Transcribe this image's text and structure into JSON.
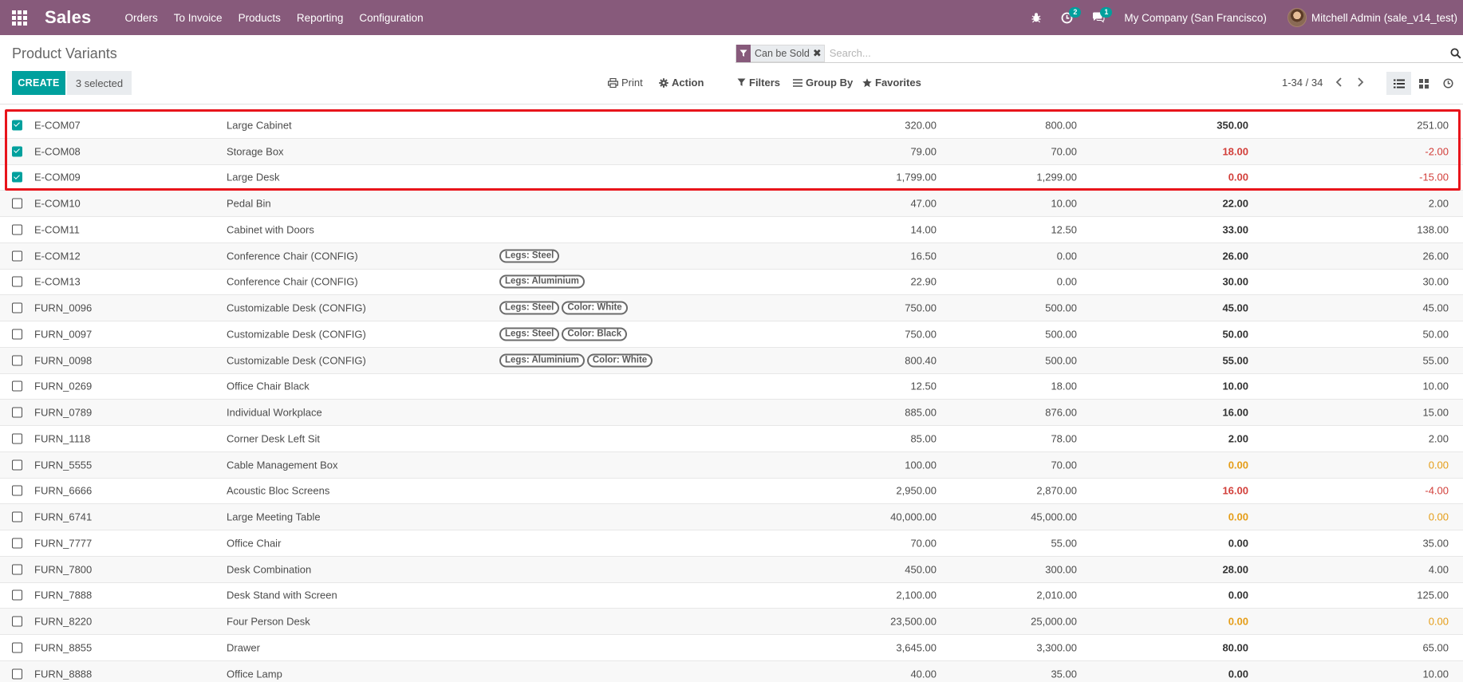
{
  "navbar": {
    "app_name": "Sales",
    "menu": [
      "Orders",
      "To Invoice",
      "Products",
      "Reporting",
      "Configuration"
    ],
    "activity_count": "2",
    "messages_count": "1",
    "company": "My Company (San Francisco)",
    "user": "Mitchell Admin (sale_v14_test)",
    "bg_color": "#875a7b"
  },
  "control_panel": {
    "title": "Product Variants",
    "create_label": "CREATE",
    "selected_label": "3 selected",
    "print_label": "Print",
    "action_label": "Action",
    "filters_label": "Filters",
    "group_by_label": "Group By",
    "favorites_label": "Favorites",
    "pager": "1-34 / 34",
    "facet_label": "Can be Sold",
    "facet_remove": "✖",
    "search_placeholder": "Search..."
  },
  "rows": [
    {
      "checked": true,
      "ref": "E-COM07",
      "name": "Large Cabinet",
      "attrs": [],
      "price": "320.00",
      "cost": "800.00",
      "onhand": "350.00",
      "onhand_color": "",
      "forecast": "251.00",
      "forecast_color": ""
    },
    {
      "checked": true,
      "ref": "E-COM08",
      "name": "Storage Box",
      "attrs": [],
      "price": "79.00",
      "cost": "70.00",
      "onhand": "18.00",
      "onhand_color": "red",
      "forecast": "-2.00",
      "forecast_color": "red"
    },
    {
      "checked": true,
      "ref": "E-COM09",
      "name": "Large Desk",
      "attrs": [],
      "price": "1,799.00",
      "cost": "1,299.00",
      "onhand": "0.00",
      "onhand_color": "red",
      "forecast": "-15.00",
      "forecast_color": "red"
    },
    {
      "checked": false,
      "ref": "E-COM10",
      "name": "Pedal Bin",
      "attrs": [],
      "price": "47.00",
      "cost": "10.00",
      "onhand": "22.00",
      "onhand_color": "",
      "forecast": "2.00",
      "forecast_color": ""
    },
    {
      "checked": false,
      "ref": "E-COM11",
      "name": "Cabinet with Doors",
      "attrs": [],
      "price": "14.00",
      "cost": "12.50",
      "onhand": "33.00",
      "onhand_color": "",
      "forecast": "138.00",
      "forecast_color": ""
    },
    {
      "checked": false,
      "ref": "E-COM12",
      "name": "Conference Chair (CONFIG)",
      "attrs": [
        "Legs: Steel"
      ],
      "price": "16.50",
      "cost": "0.00",
      "onhand": "26.00",
      "onhand_color": "",
      "forecast": "26.00",
      "forecast_color": ""
    },
    {
      "checked": false,
      "ref": "E-COM13",
      "name": "Conference Chair (CONFIG)",
      "attrs": [
        "Legs: Aluminium"
      ],
      "price": "22.90",
      "cost": "0.00",
      "onhand": "30.00",
      "onhand_color": "",
      "forecast": "30.00",
      "forecast_color": ""
    },
    {
      "checked": false,
      "ref": "FURN_0096",
      "name": "Customizable Desk (CONFIG)",
      "attrs": [
        "Legs: Steel",
        "Color: White"
      ],
      "price": "750.00",
      "cost": "500.00",
      "onhand": "45.00",
      "onhand_color": "",
      "forecast": "45.00",
      "forecast_color": ""
    },
    {
      "checked": false,
      "ref": "FURN_0097",
      "name": "Customizable Desk (CONFIG)",
      "attrs": [
        "Legs: Steel",
        "Color: Black"
      ],
      "price": "750.00",
      "cost": "500.00",
      "onhand": "50.00",
      "onhand_color": "",
      "forecast": "50.00",
      "forecast_color": ""
    },
    {
      "checked": false,
      "ref": "FURN_0098",
      "name": "Customizable Desk (CONFIG)",
      "attrs": [
        "Legs: Aluminium",
        "Color: White"
      ],
      "price": "800.40",
      "cost": "500.00",
      "onhand": "55.00",
      "onhand_color": "",
      "forecast": "55.00",
      "forecast_color": ""
    },
    {
      "checked": false,
      "ref": "FURN_0269",
      "name": "Office Chair Black",
      "attrs": [],
      "price": "12.50",
      "cost": "18.00",
      "onhand": "10.00",
      "onhand_color": "",
      "forecast": "10.00",
      "forecast_color": ""
    },
    {
      "checked": false,
      "ref": "FURN_0789",
      "name": "Individual Workplace",
      "attrs": [],
      "price": "885.00",
      "cost": "876.00",
      "onhand": "16.00",
      "onhand_color": "",
      "forecast": "15.00",
      "forecast_color": ""
    },
    {
      "checked": false,
      "ref": "FURN_1118",
      "name": "Corner Desk Left Sit",
      "attrs": [],
      "price": "85.00",
      "cost": "78.00",
      "onhand": "2.00",
      "onhand_color": "",
      "forecast": "2.00",
      "forecast_color": ""
    },
    {
      "checked": false,
      "ref": "FURN_5555",
      "name": "Cable Management Box",
      "attrs": [],
      "price": "100.00",
      "cost": "70.00",
      "onhand": "0.00",
      "onhand_color": "orange",
      "forecast": "0.00",
      "forecast_color": "orange"
    },
    {
      "checked": false,
      "ref": "FURN_6666",
      "name": "Acoustic Bloc Screens",
      "attrs": [],
      "price": "2,950.00",
      "cost": "2,870.00",
      "onhand": "16.00",
      "onhand_color": "red",
      "forecast": "-4.00",
      "forecast_color": "red"
    },
    {
      "checked": false,
      "ref": "FURN_6741",
      "name": "Large Meeting Table",
      "attrs": [],
      "price": "40,000.00",
      "cost": "45,000.00",
      "onhand": "0.00",
      "onhand_color": "orange",
      "forecast": "0.00",
      "forecast_color": "orange"
    },
    {
      "checked": false,
      "ref": "FURN_7777",
      "name": "Office Chair",
      "attrs": [],
      "price": "70.00",
      "cost": "55.00",
      "onhand": "0.00",
      "onhand_color": "",
      "forecast": "35.00",
      "forecast_color": ""
    },
    {
      "checked": false,
      "ref": "FURN_7800",
      "name": "Desk Combination",
      "attrs": [],
      "price": "450.00",
      "cost": "300.00",
      "onhand": "28.00",
      "onhand_color": "",
      "forecast": "4.00",
      "forecast_color": ""
    },
    {
      "checked": false,
      "ref": "FURN_7888",
      "name": "Desk Stand with Screen",
      "attrs": [],
      "price": "2,100.00",
      "cost": "2,010.00",
      "onhand": "0.00",
      "onhand_color": "",
      "forecast": "125.00",
      "forecast_color": ""
    },
    {
      "checked": false,
      "ref": "FURN_8220",
      "name": "Four Person Desk",
      "attrs": [],
      "price": "23,500.00",
      "cost": "25,000.00",
      "onhand": "0.00",
      "onhand_color": "orange",
      "forecast": "0.00",
      "forecast_color": "orange"
    },
    {
      "checked": false,
      "ref": "FURN_8855",
      "name": "Drawer",
      "attrs": [],
      "price": "3,645.00",
      "cost": "3,300.00",
      "onhand": "80.00",
      "onhand_color": "",
      "forecast": "65.00",
      "forecast_color": ""
    },
    {
      "checked": false,
      "ref": "FURN_8888",
      "name": "Office Lamp",
      "attrs": [],
      "price": "40.00",
      "cost": "35.00",
      "onhand": "0.00",
      "onhand_color": "",
      "forecast": "10.00",
      "forecast_color": ""
    }
  ],
  "colors": {
    "accent": "#00a09d",
    "brand": "#875a7b",
    "negative": "#d23f3a",
    "warning": "#e59d18",
    "highlight_border": "#e8141b"
  },
  "icons": {
    "apps": "apps-grid-icon",
    "bug": "bug-icon",
    "activity": "clock-icon",
    "messages": "chat-icon",
    "filter": "funnel-icon",
    "search": "search-icon",
    "print": "print-icon",
    "action": "gear-icon",
    "group_by": "bars-icon",
    "favorites": "star-icon",
    "list_view": "list-icon",
    "kanban_view": "grid-icon",
    "activity_view": "clock-icon"
  }
}
